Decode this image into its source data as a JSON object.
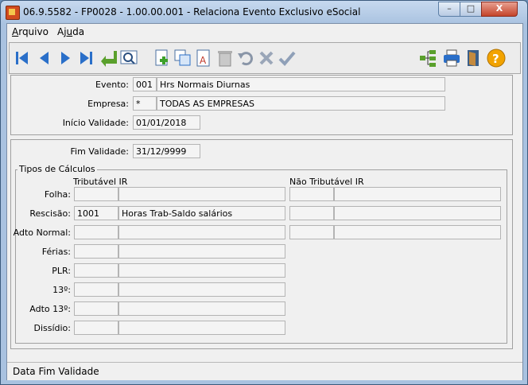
{
  "window": {
    "title": "06.9.5582 - FP0028 - 1.00.00.001 - Relaciona Evento Exclusivo eSocial",
    "minimize": "–",
    "maximize": "□",
    "close": "X"
  },
  "menu": [
    {
      "label": "Arquivo"
    },
    {
      "label": "Ajuda"
    }
  ],
  "toolbar_icons": [
    "first-record-icon",
    "previous-record-icon",
    "next-record-icon",
    "last-record-icon",
    "go-to-icon",
    "zoom-icon",
    "new-record-icon",
    "copy-record-icon",
    "edit-record-icon",
    "delete-icon",
    "undo-icon",
    "cancel-icon",
    "confirm-icon",
    "hierarchy-icon",
    "print-icon",
    "exit-icon",
    "help-icon"
  ],
  "header": {
    "evento_label": "Evento:",
    "evento_code": "001",
    "evento_desc": "Hrs Normais Diurnas",
    "empresa_label": "Empresa:",
    "empresa_code": "*",
    "empresa_desc": "TODAS AS EMPRESAS",
    "inicio_label": "Início Validade:",
    "inicio_value": "01/01/2018"
  },
  "detail": {
    "fim_label": "Fim Validade:",
    "fim_value": "31/12/9999",
    "group_title": "Tipos de Cálculos",
    "col_trib": "Tributável IR",
    "col_nao_trib": "Não Tributável IR",
    "rows": [
      {
        "label": "Folha:",
        "trib_code": "",
        "trib_desc": "",
        "nao_code": "",
        "nao_desc": "",
        "has_nao": true
      },
      {
        "label": "Rescisão:",
        "trib_code": "1001",
        "trib_desc": "Horas Trab-Saldo  salários",
        "nao_code": "",
        "nao_desc": "",
        "has_nao": true
      },
      {
        "label": "Adto Normal:",
        "trib_code": "",
        "trib_desc": "",
        "nao_code": "",
        "nao_desc": "",
        "has_nao": true
      },
      {
        "label": "Férias:",
        "trib_code": "",
        "trib_desc": "",
        "has_nao": false
      },
      {
        "label": "PLR:",
        "trib_code": "",
        "trib_desc": "",
        "has_nao": false
      },
      {
        "label": "13º:",
        "trib_code": "",
        "trib_desc": "",
        "has_nao": false
      },
      {
        "label": "Adto 13º:",
        "trib_code": "",
        "trib_desc": "",
        "has_nao": false
      },
      {
        "label": "Dissídio:",
        "trib_code": "",
        "trib_desc": "",
        "has_nao": false
      }
    ]
  },
  "status": {
    "text": "Data Fim Validade"
  }
}
